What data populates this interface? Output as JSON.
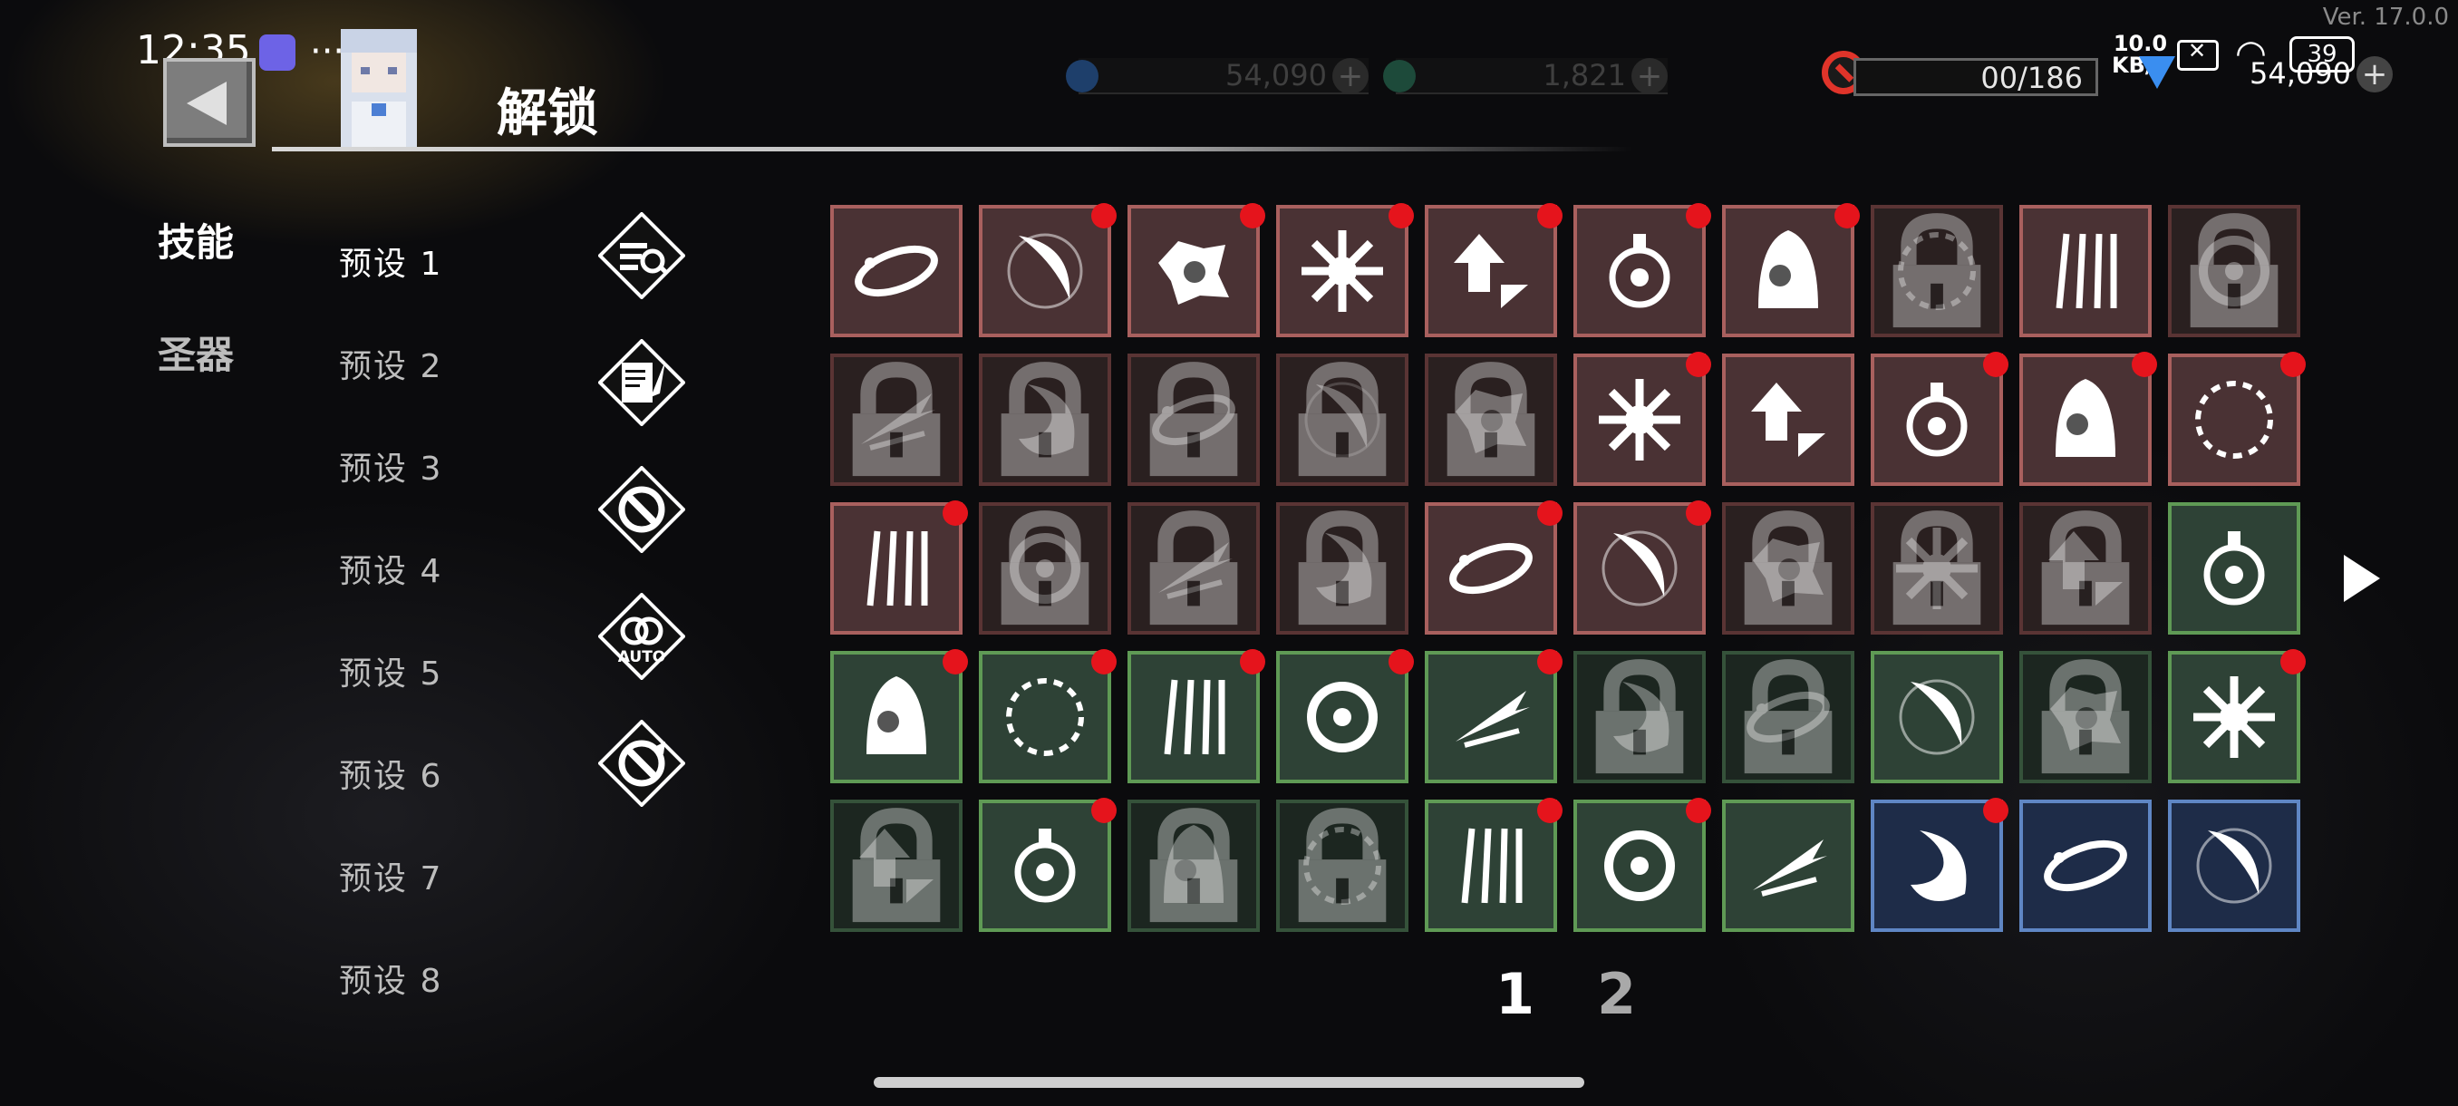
{
  "status_bar": {
    "time": "12:35",
    "dots": "···",
    "net_speed": "10.0",
    "net_unit": "KB/S",
    "battery": "39"
  },
  "version": "Ver. 17.0.0",
  "resources": {
    "gem": "54,090",
    "coin": "1,821",
    "unlock_count": "00/186",
    "diamond": "54,090"
  },
  "header": {
    "title": "解锁"
  },
  "side_tabs": [
    "技能",
    "圣器"
  ],
  "presets": [
    "预设 1",
    "预设 2",
    "预设 3",
    "预设 4",
    "预设 5",
    "预设 6",
    "预设 7",
    "预设 8"
  ],
  "action_icons": [
    "search-list-icon",
    "scroll-quill-icon",
    "ban-icon",
    "auto-icon",
    "refresh-icon"
  ],
  "auto_label": "AUTO",
  "colors": {
    "red_frame": "#a9605e",
    "green_frame": "#5f9a55",
    "blue_frame": "#5f86c4",
    "notify_dot": "#e5141c"
  },
  "skills": [
    [
      {
        "c": "red",
        "s": "u",
        "d": 0
      },
      {
        "c": "red",
        "s": "u",
        "d": 1
      },
      {
        "c": "red",
        "s": "u",
        "d": 1
      },
      {
        "c": "red",
        "s": "u",
        "d": 1
      },
      {
        "c": "red",
        "s": "u",
        "d": 1
      },
      {
        "c": "red",
        "s": "u",
        "d": 1
      },
      {
        "c": "red",
        "s": "u",
        "d": 1
      },
      {
        "c": "red",
        "s": "l",
        "d": 0
      },
      {
        "c": "red",
        "s": "u",
        "d": 0
      },
      {
        "c": "red",
        "s": "l",
        "d": 0
      }
    ],
    [
      {
        "c": "red",
        "s": "l",
        "d": 0
      },
      {
        "c": "red",
        "s": "l",
        "d": 0
      },
      {
        "c": "red",
        "s": "l",
        "d": 0
      },
      {
        "c": "red",
        "s": "l",
        "d": 0
      },
      {
        "c": "red",
        "s": "l",
        "d": 0
      },
      {
        "c": "red",
        "s": "u",
        "d": 1
      },
      {
        "c": "red",
        "s": "u",
        "d": 0
      },
      {
        "c": "red",
        "s": "u",
        "d": 1
      },
      {
        "c": "red",
        "s": "u",
        "d": 1
      },
      {
        "c": "red",
        "s": "u",
        "d": 1
      }
    ],
    [
      {
        "c": "red",
        "s": "u",
        "d": 1
      },
      {
        "c": "red",
        "s": "l",
        "d": 0
      },
      {
        "c": "red",
        "s": "l",
        "d": 0
      },
      {
        "c": "red",
        "s": "l",
        "d": 0
      },
      {
        "c": "red",
        "s": "u",
        "d": 1
      },
      {
        "c": "red",
        "s": "u",
        "d": 1
      },
      {
        "c": "red",
        "s": "l",
        "d": 0
      },
      {
        "c": "red",
        "s": "l",
        "d": 0
      },
      {
        "c": "red",
        "s": "l",
        "d": 0
      },
      {
        "c": "green",
        "s": "u",
        "d": 0
      }
    ],
    [
      {
        "c": "green",
        "s": "u",
        "d": 1
      },
      {
        "c": "green",
        "s": "u",
        "d": 1
      },
      {
        "c": "green",
        "s": "u",
        "d": 1
      },
      {
        "c": "green",
        "s": "u",
        "d": 1
      },
      {
        "c": "green",
        "s": "u",
        "d": 1
      },
      {
        "c": "green",
        "s": "l",
        "d": 0
      },
      {
        "c": "green",
        "s": "l",
        "d": 0
      },
      {
        "c": "green",
        "s": "u",
        "d": 0
      },
      {
        "c": "green",
        "s": "l",
        "d": 0
      },
      {
        "c": "green",
        "s": "u",
        "d": 1
      }
    ],
    [
      {
        "c": "green",
        "s": "l",
        "d": 0
      },
      {
        "c": "green",
        "s": "u",
        "d": 1
      },
      {
        "c": "green",
        "s": "l",
        "d": 0
      },
      {
        "c": "green",
        "s": "l",
        "d": 0
      },
      {
        "c": "green",
        "s": "u",
        "d": 1
      },
      {
        "c": "green",
        "s": "u",
        "d": 1
      },
      {
        "c": "green",
        "s": "u",
        "d": 0
      },
      {
        "c": "blue",
        "s": "u",
        "d": 1
      },
      {
        "c": "blue",
        "s": "u",
        "d": 0
      },
      {
        "c": "blue",
        "s": "u",
        "d": 0
      }
    ]
  ],
  "pages": [
    "1",
    "2"
  ]
}
